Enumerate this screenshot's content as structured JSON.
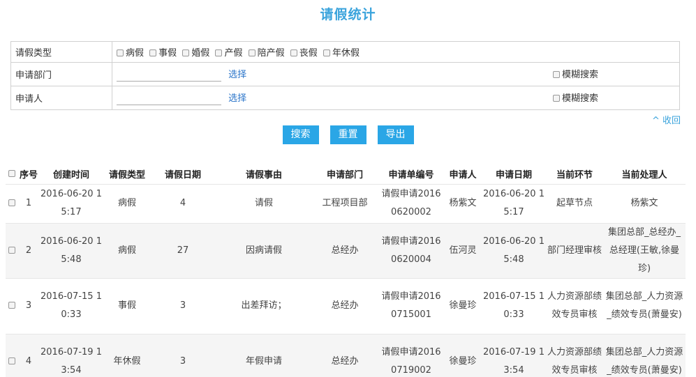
{
  "title": "请假统计",
  "filter": {
    "type_label": "请假类型",
    "types": [
      "病假",
      "事假",
      "婚假",
      "产假",
      "陪产假",
      "丧假",
      "年休假"
    ],
    "dept_label": "申请部门",
    "person_label": "申请人",
    "pick_label": "选择",
    "fuzzy_label": "模糊搜索"
  },
  "collapse_label": "^ 收回",
  "buttons": {
    "search": "搜索",
    "reset": "重置",
    "export": "导出"
  },
  "table": {
    "headers": [
      "序号",
      "创建时间",
      "请假类型",
      "请假日期",
      "请假事由",
      "申请部门",
      "申请单编号",
      "申请人",
      "申请日期",
      "当前环节",
      "当前处理人"
    ],
    "rows": [
      {
        "no": "1",
        "created": "2016-06-20 15:17",
        "type": "病假",
        "days": "4",
        "reason": "请假",
        "dept": "工程项目部",
        "code": "请假申请20160620002",
        "person": "杨紫文",
        "apply_date": "2016-06-20 15:17",
        "step": "起草节点",
        "handler": "杨紫文"
      },
      {
        "no": "2",
        "created": "2016-06-20 15:48",
        "type": "病假",
        "days": "27",
        "reason": "因病请假",
        "dept": "总经办",
        "code": "请假申请20160620004",
        "person": "伍河灵",
        "apply_date": "2016-06-20 15:48",
        "step": "部门经理审核",
        "handler": "集团总部_总经办_总经理(王敏,徐曼珍)"
      },
      {
        "no": "3",
        "created": "2016-07-15 10:33",
        "type": "事假",
        "days": "3",
        "reason": "出差拜访；",
        "dept": "总经办",
        "code": "请假申请20160715001",
        "person": "徐曼珍",
        "apply_date": "2016-07-15 10:33",
        "step": "人力资源部绩效专员审核",
        "handler": "集团总部_人力资源_绩效专员(萧曼安)"
      },
      {
        "no": "4",
        "created": "2016-07-19 13:54",
        "type": "年休假",
        "days": "3",
        "reason": "年假申请",
        "dept": "总经办",
        "code": "请假申请20160719002",
        "person": "徐曼珍",
        "apply_date": "2016-07-19 13:54",
        "step": "人力资源部绩效专员审核",
        "handler": "集团总部_人力资源_绩效专员(萧曼安)"
      }
    ]
  }
}
